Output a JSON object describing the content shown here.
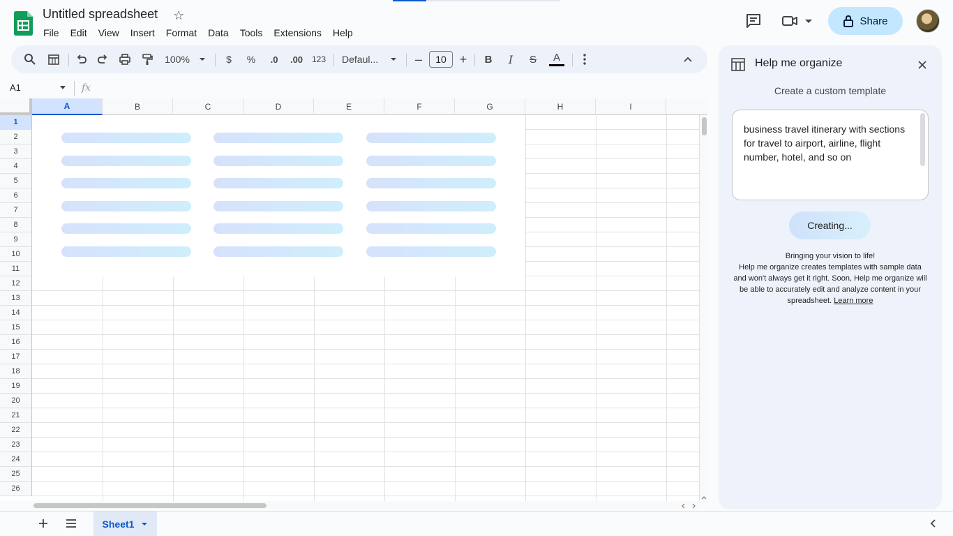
{
  "doc": {
    "title": "Untitled spreadsheet"
  },
  "menu": [
    "File",
    "Edit",
    "View",
    "Insert",
    "Format",
    "Data",
    "Tools",
    "Extensions",
    "Help"
  ],
  "header": {
    "share_label": "Share"
  },
  "toolbar": {
    "zoom": "100%",
    "currency": "$",
    "percent": "%",
    "decrease_decimals": ".0",
    "increase_decimals": ".00",
    "number_format": "123",
    "font": "Defaul...",
    "font_size": "10",
    "bold": "B",
    "italic": "I",
    "strikethrough": "S",
    "text_color": "A",
    "minus": "–",
    "plus": "+"
  },
  "formula_bar": {
    "cell_ref": "A1",
    "fx": "fx"
  },
  "grid": {
    "columns": [
      "A",
      "B",
      "C",
      "D",
      "E",
      "F",
      "G",
      "H",
      "I"
    ],
    "rows": [
      "1",
      "2",
      "3",
      "4",
      "5",
      "6",
      "7",
      "8",
      "9",
      "10",
      "11",
      "12",
      "13",
      "14",
      "15",
      "16",
      "17",
      "18",
      "19",
      "20",
      "21",
      "22",
      "23",
      "24",
      "25",
      "26"
    ],
    "selected_cell": "A1"
  },
  "sheets": {
    "active": "Sheet1"
  },
  "panel": {
    "title": "Help me organize",
    "subtitle": "Create a custom template",
    "prompt": "business travel itinerary with sections for travel to airport, airline, flight number, hotel, and so on",
    "creating_label": "Creating...",
    "disclaimer_line1": "Bringing your vision to life!",
    "disclaimer_body": "Help me organize creates templates with sample data and won't always get it right. Soon, Help me organize will be able to accurately edit and analyze content in your spreadsheet.",
    "learn_more": "Learn more"
  },
  "colors": {
    "accent": "#0b57d0",
    "share_bg": "#c2e7ff",
    "sheets_green": "#0f9d58"
  }
}
